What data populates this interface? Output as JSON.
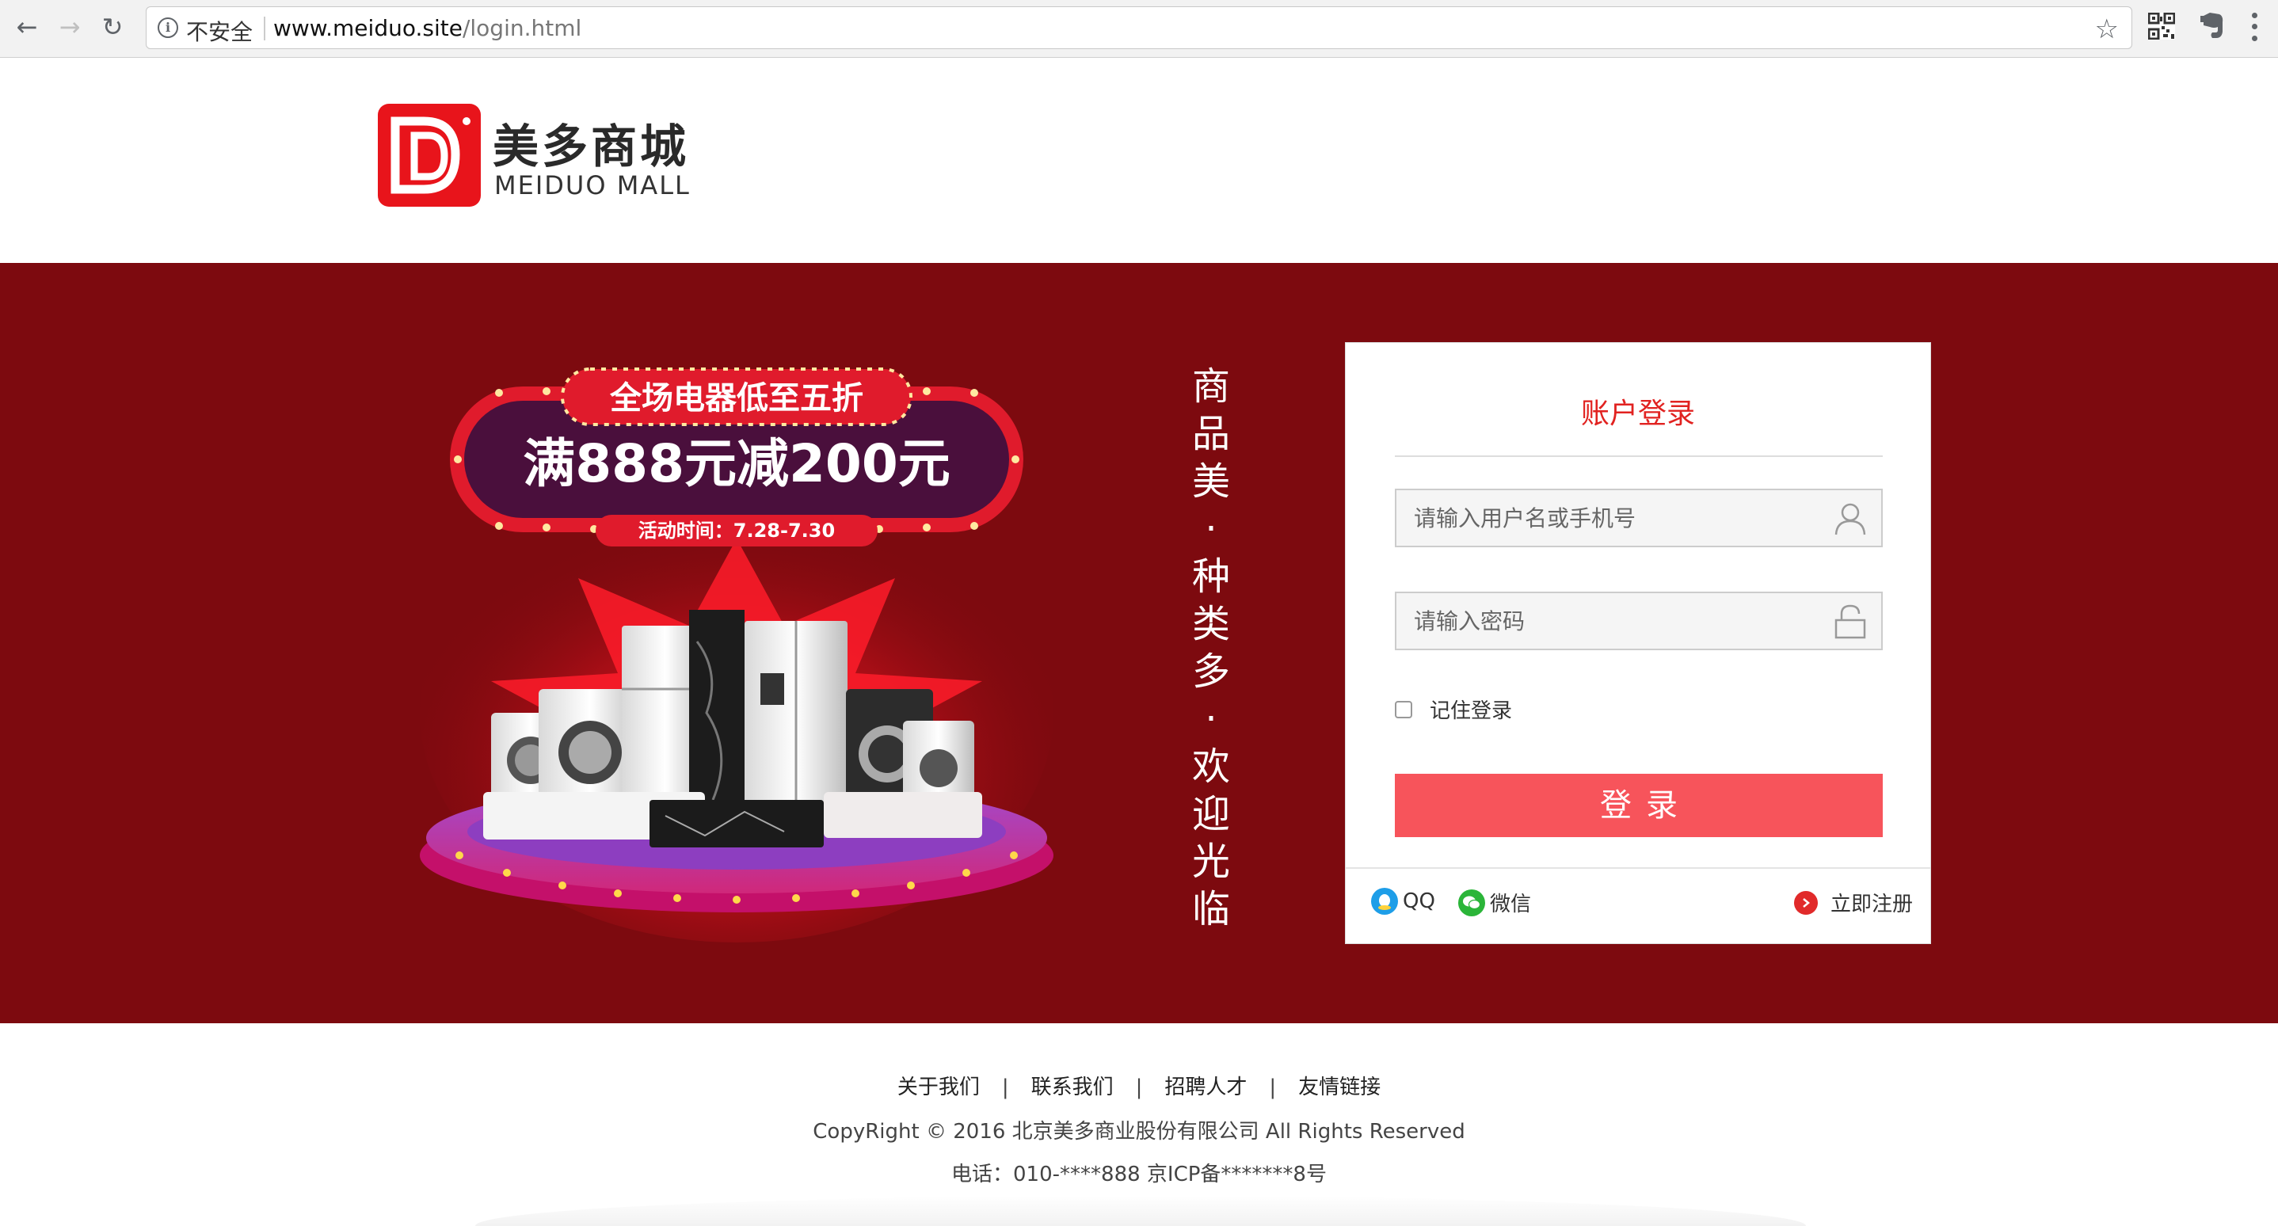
{
  "browser": {
    "security_label": "不安全",
    "url_host": "www.meiduo.site",
    "url_path": "/login.html"
  },
  "header": {
    "logo_letters": "DD",
    "brand_cn": "美多商城",
    "brand_en": "MEIDUO MALL"
  },
  "promo": {
    "headline": "全场电器低至五折",
    "offer": "满888元减200元",
    "period": "活动时间：7.28-7.30"
  },
  "slogan": [
    "商",
    "品",
    "美",
    "·",
    "种",
    "类",
    "多",
    "·",
    "欢",
    "迎",
    "光",
    "临"
  ],
  "login": {
    "title": "账户登录",
    "username_placeholder": "请输入用户名或手机号",
    "password_placeholder": "请输入密码",
    "remember_label": "记住登录",
    "remember_checked": false,
    "submit_label": "登录",
    "qq_label": "QQ",
    "wechat_label": "微信",
    "register_label": "立即注册"
  },
  "footer": {
    "links": [
      "关于我们",
      "联系我们",
      "招聘人才",
      "友情链接"
    ],
    "copyright": "CopyRight © 2016 北京美多商业股份有限公司 All Rights Reserved",
    "phone": "电话：010-****888    京ICP备*******8号"
  },
  "colors": {
    "band": "#7d0a0f",
    "accent_red": "#e12220",
    "button": "#f7545b"
  }
}
